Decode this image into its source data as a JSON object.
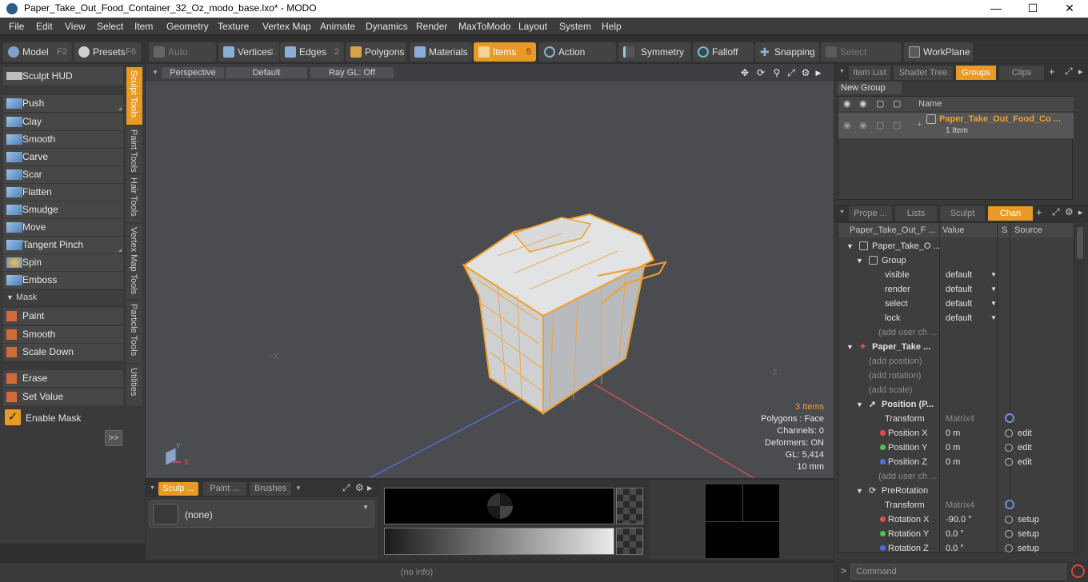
{
  "window": {
    "title": "Paper_Take_Out_Food_Container_32_Oz_modo_base.lxo* - MODO"
  },
  "menu": [
    "File",
    "Edit",
    "View",
    "Select",
    "Item",
    "Geometry",
    "Texture",
    "Vertex Map",
    "Animate",
    "Dynamics",
    "Render",
    "MaxToModo",
    "Layout",
    "System",
    "Help"
  ],
  "toolbar": {
    "model": "Model",
    "model_key": "F2",
    "presets": "Presets",
    "presets_key": "F6",
    "auto_select": "Auto Select",
    "vertices": "Vertices",
    "vertices_key": "1",
    "edges": "Edges",
    "edges_key": "2",
    "polygons": "Polygons",
    "materials": "Materials",
    "items": "Items",
    "items_key": "5",
    "action_center": "Action Center",
    "symmetry": "Symmetry",
    "falloff": "Falloff",
    "snapping": "Snapping",
    "select_through": "Select Through",
    "workplane": "WorkPlane"
  },
  "left": {
    "sculpt_hud": "Sculpt HUD",
    "tools": [
      "Push",
      "Clay",
      "Smooth",
      "Carve",
      "Scar",
      "Flatten",
      "Smudge",
      "Move",
      "Tangent Pinch",
      "Spin",
      "Emboss"
    ],
    "mask_header": "Mask",
    "mask_tools": [
      "Paint",
      "Smooth",
      "Scale Down"
    ],
    "erase": "Erase",
    "set_value": "Set Value",
    "enable_mask": "Enable Mask",
    "expand": ">>",
    "vtabs": [
      "Sculpt Tools",
      "Paint Tools",
      "Hair Tools",
      "Vertex Map Tools",
      "Particle Tools",
      "Utilities"
    ]
  },
  "viewport": {
    "perspective": "Perspective",
    "default": "Default",
    "raygl": "Ray GL: Off",
    "axis_neg_x": "-X",
    "axis_neg_z": "-Z",
    "gizmo_y": "Y",
    "gizmo_x": "X",
    "stats": {
      "items": "3 Items",
      "polygons": "Polygons : Face",
      "channels": "Channels: 0",
      "deformers": "Deformers: ON",
      "gl": "GL: 5,414",
      "units": "10 mm"
    }
  },
  "bottom": {
    "tab_sculpt": "Sculp ...",
    "tab_paint": "Paint ...",
    "tab_brushes": "Brushes",
    "none": "(none)"
  },
  "status": {
    "info": "(no info)"
  },
  "right": {
    "top_tabs": [
      "Item List",
      "Shader Tree",
      "Groups",
      "Clips"
    ],
    "new_group": "New Group",
    "name_header": "Name",
    "group_name": "Paper_Take_Out_Food_Co ...",
    "group_count": "1 Item",
    "mid_tabs": [
      "Prope ...",
      "Lists",
      "Sculpt",
      "Chan"
    ],
    "ch_headers": [
      "Paper_Take_Out_F ...",
      "Value",
      "S",
      "Source"
    ],
    "channels": [
      {
        "name": "Paper_Take_O ...",
        "value": "",
        "source": "",
        "indent": 1
      },
      {
        "name": "Group",
        "value": "",
        "source": "",
        "indent": 2
      },
      {
        "name": "visible",
        "value": "default",
        "source": "",
        "indent": 3
      },
      {
        "name": "render",
        "value": "default",
        "source": "",
        "indent": 3
      },
      {
        "name": "select",
        "value": "default",
        "source": "",
        "indent": 3
      },
      {
        "name": "lock",
        "value": "default",
        "source": "",
        "indent": 3
      },
      {
        "name": "(add user ch ...",
        "value": "",
        "source": "",
        "indent": 3
      },
      {
        "name": "Paper_Take ...",
        "value": "",
        "source": "",
        "indent": 1
      },
      {
        "name": "(add position)",
        "value": "",
        "source": "",
        "indent": 2
      },
      {
        "name": "(add rotation)",
        "value": "",
        "source": "",
        "indent": 2
      },
      {
        "name": "(add scale)",
        "value": "",
        "source": "",
        "indent": 2
      },
      {
        "name": "Position (P...",
        "value": "",
        "source": "",
        "indent": 2
      },
      {
        "name": "Transform",
        "value": "Matrix4",
        "source": "",
        "indent": 3
      },
      {
        "name": "Position X",
        "value": "0 m",
        "source": "edit",
        "indent": 3
      },
      {
        "name": "Position Y",
        "value": "0 m",
        "source": "edit",
        "indent": 3
      },
      {
        "name": "Position Z",
        "value": "0 m",
        "source": "edit",
        "indent": 3
      },
      {
        "name": "(add user ch ...",
        "value": "",
        "source": "",
        "indent": 3
      },
      {
        "name": "PreRotation",
        "value": "",
        "source": "",
        "indent": 2
      },
      {
        "name": "Transform",
        "value": "Matrix4",
        "source": "",
        "indent": 3
      },
      {
        "name": "Rotation X",
        "value": "-90.0 °",
        "source": "setup",
        "indent": 3
      },
      {
        "name": "Rotation Y",
        "value": "0.0 °",
        "source": "setup",
        "indent": 3
      },
      {
        "name": "Rotation Z",
        "value": "0.0 °",
        "source": "setup",
        "indent": 3
      }
    ],
    "command": "Command"
  },
  "colors": {
    "accent": "#e89a24",
    "x_axis": "#e05050",
    "y_axis": "#50c050",
    "z_axis": "#5070e0"
  }
}
